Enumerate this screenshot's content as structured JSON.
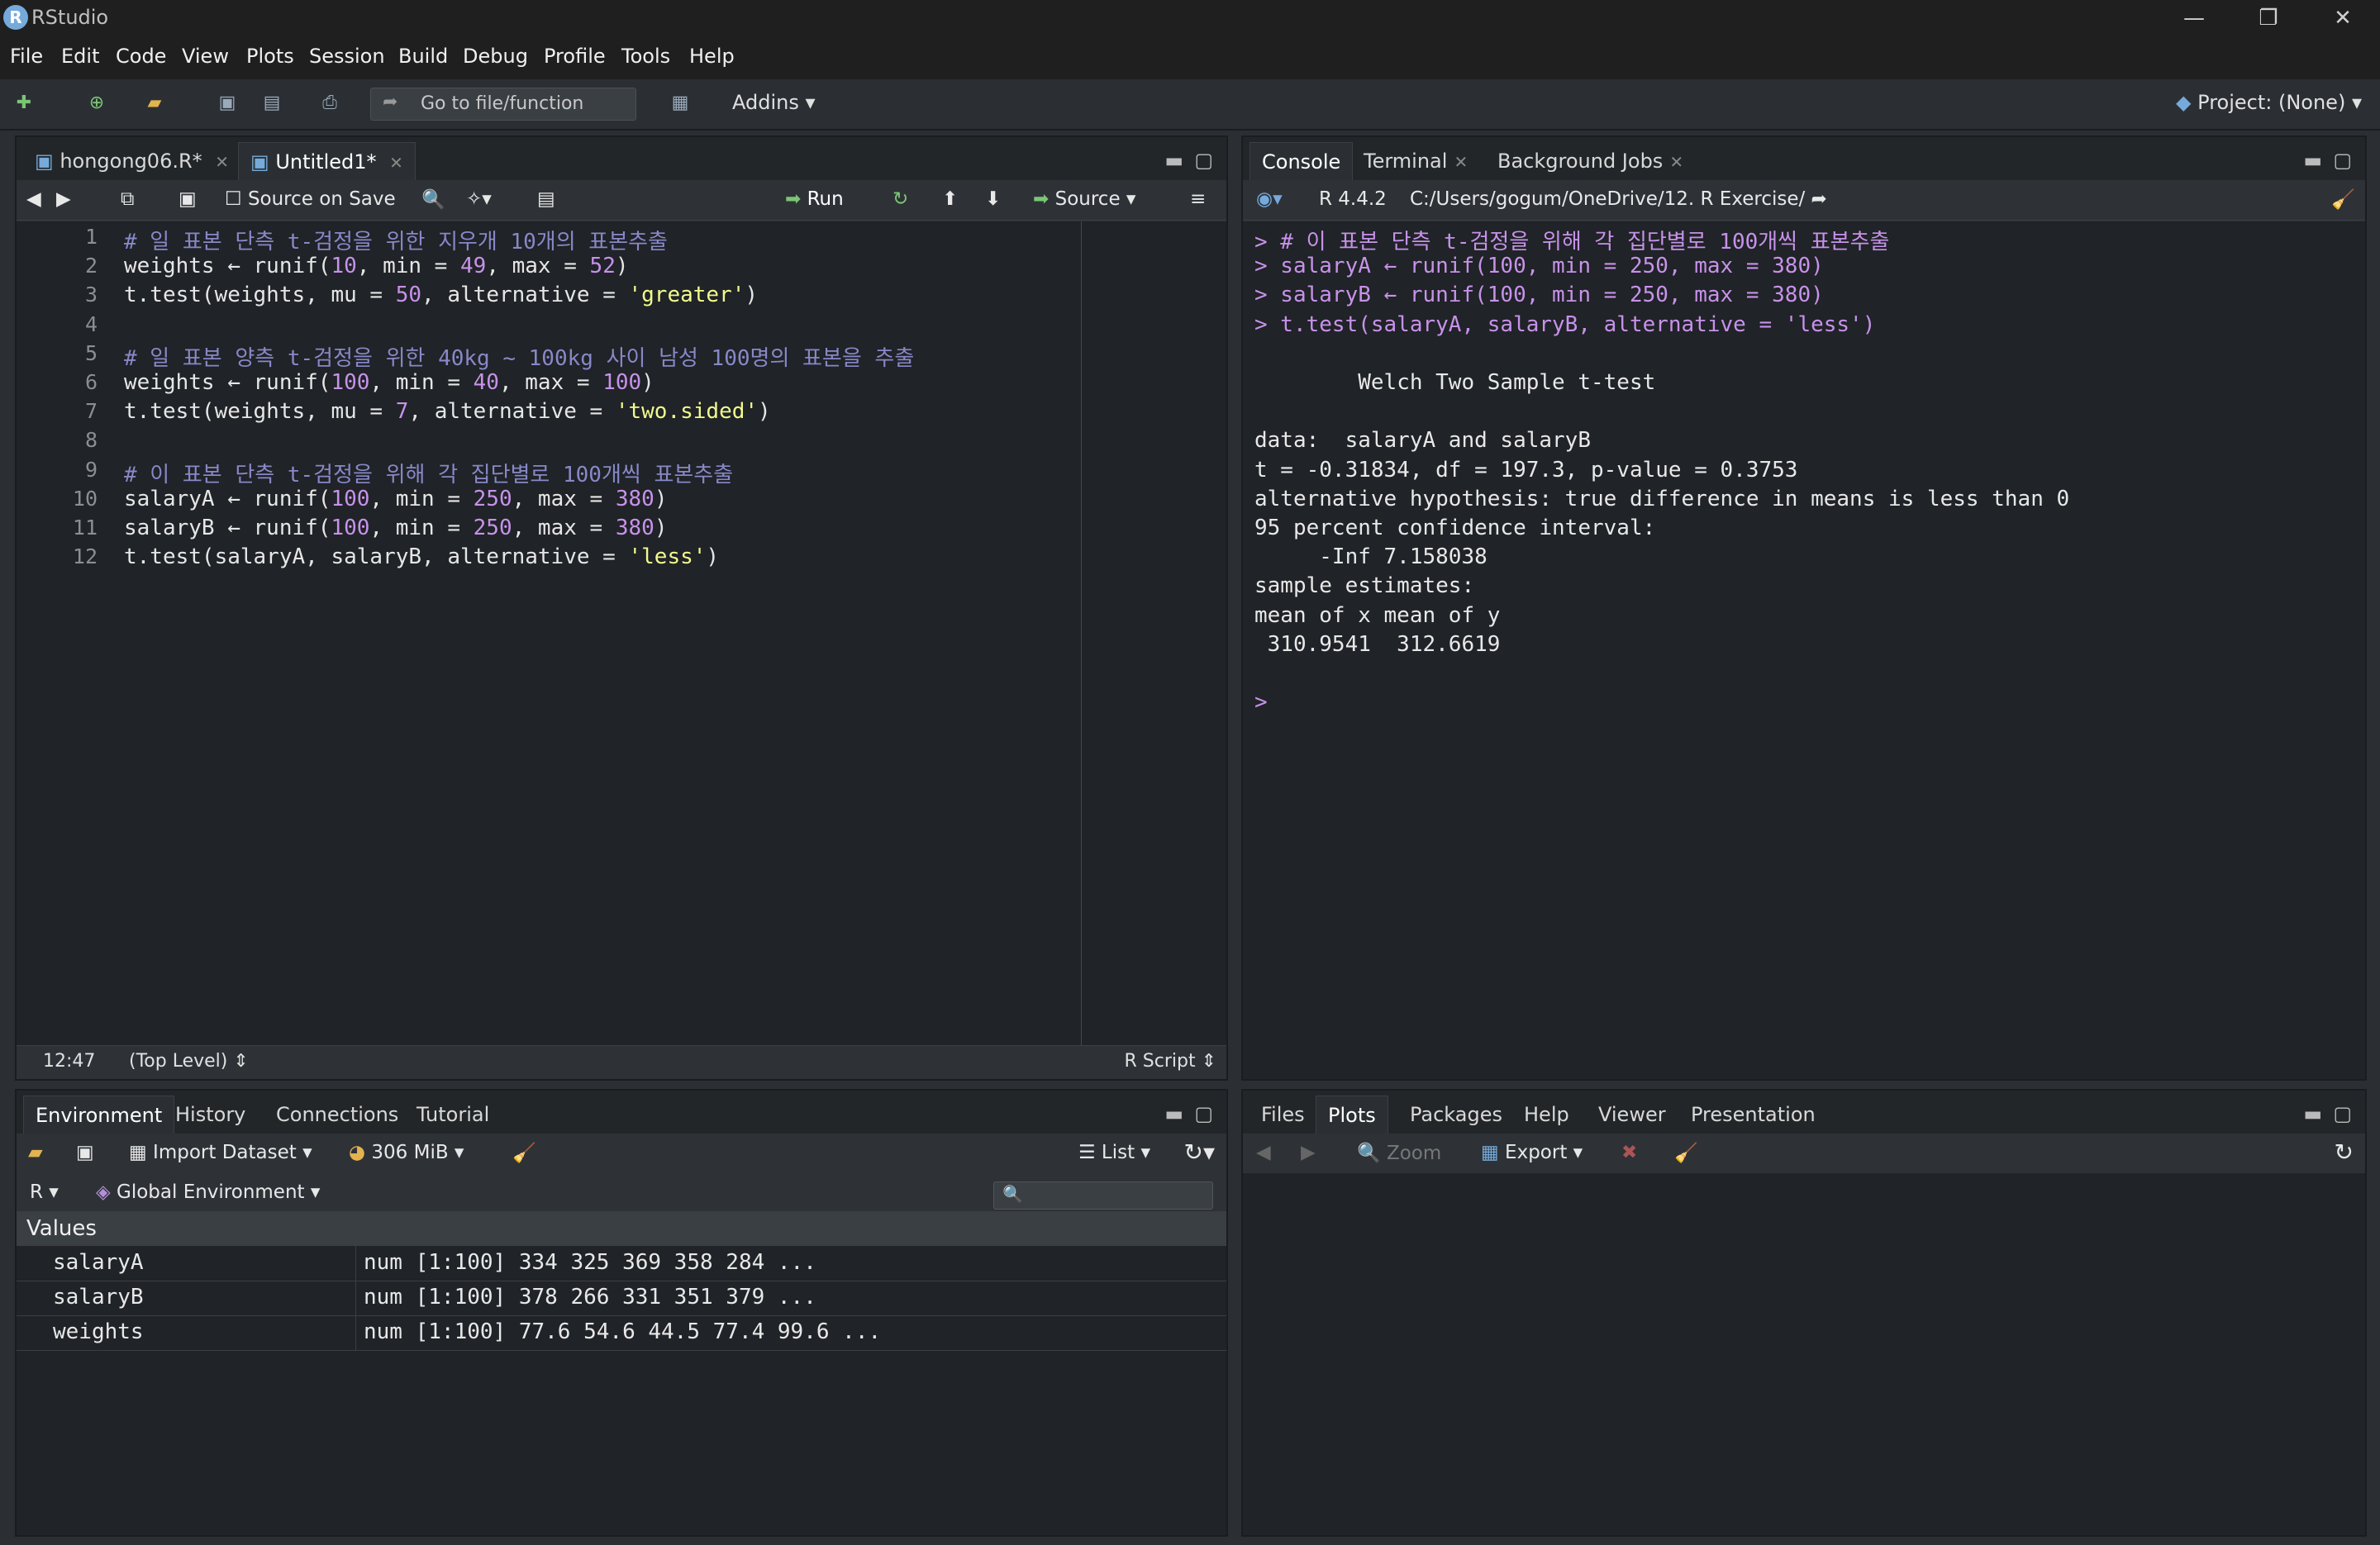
{
  "window": {
    "title": "RStudio",
    "controls": [
      "—",
      "❐",
      "✕"
    ]
  },
  "menu": [
    "File",
    "Edit",
    "Code",
    "View",
    "Plots",
    "Session",
    "Build",
    "Debug",
    "Profile",
    "Tools",
    "Help"
  ],
  "toolbar": {
    "goto_placeholder": "Go to file/function",
    "addins_label": "Addins",
    "project_label": "Project: (None)"
  },
  "editor": {
    "tabs": [
      {
        "label": "hongong06.R*",
        "active": false
      },
      {
        "label": "Untitled1*",
        "active": true
      }
    ],
    "source_on_save": "Source on Save",
    "run_label": "Run",
    "source_label": "Source",
    "lines": [
      {
        "n": "1",
        "parts": [
          {
            "t": "# 일 표본 단측 t-검정을 위한 지우개 10개의 표본추출",
            "c": "comment"
          }
        ]
      },
      {
        "n": "2",
        "parts": [
          {
            "t": "weights ← runif(",
            "c": "op"
          },
          {
            "t": "10",
            "c": "num"
          },
          {
            "t": ", min = ",
            "c": "op"
          },
          {
            "t": "49",
            "c": "num"
          },
          {
            "t": ", max = ",
            "c": "op"
          },
          {
            "t": "52",
            "c": "num"
          },
          {
            "t": ")",
            "c": "op"
          }
        ]
      },
      {
        "n": "3",
        "parts": [
          {
            "t": "t.test(weights, mu = ",
            "c": "op"
          },
          {
            "t": "50",
            "c": "num"
          },
          {
            "t": ", alternative = ",
            "c": "op"
          },
          {
            "t": "'greater'",
            "c": "str"
          },
          {
            "t": ")",
            "c": "op"
          }
        ]
      },
      {
        "n": "4",
        "parts": []
      },
      {
        "n": "5",
        "parts": [
          {
            "t": "# 일 표본 양측 t-검정을 위한 40kg ~ 100kg 사이 남성 100명의 표본을 추출",
            "c": "comment"
          }
        ]
      },
      {
        "n": "6",
        "parts": [
          {
            "t": "weights ← runif(",
            "c": "op"
          },
          {
            "t": "100",
            "c": "num"
          },
          {
            "t": ", min = ",
            "c": "op"
          },
          {
            "t": "40",
            "c": "num"
          },
          {
            "t": ", max = ",
            "c": "op"
          },
          {
            "t": "100",
            "c": "num"
          },
          {
            "t": ")",
            "c": "op"
          }
        ]
      },
      {
        "n": "7",
        "parts": [
          {
            "t": "t.test(weights, mu = ",
            "c": "op"
          },
          {
            "t": "7",
            "c": "num"
          },
          {
            "t": ", alternative = ",
            "c": "op"
          },
          {
            "t": "'two.sided'",
            "c": "str"
          },
          {
            "t": ")",
            "c": "op"
          }
        ]
      },
      {
        "n": "8",
        "parts": []
      },
      {
        "n": "9",
        "parts": [
          {
            "t": "# 이 표본 단측 t-검정을 위해 각 집단별로 100개씩 표본추출",
            "c": "comment"
          }
        ]
      },
      {
        "n": "10",
        "parts": [
          {
            "t": "salaryA ← runif(",
            "c": "op"
          },
          {
            "t": "100",
            "c": "num"
          },
          {
            "t": ", min = ",
            "c": "op"
          },
          {
            "t": "250",
            "c": "num"
          },
          {
            "t": ", max = ",
            "c": "op"
          },
          {
            "t": "380",
            "c": "num"
          },
          {
            "t": ")",
            "c": "op"
          }
        ]
      },
      {
        "n": "11",
        "parts": [
          {
            "t": "salaryB ← runif(",
            "c": "op"
          },
          {
            "t": "100",
            "c": "num"
          },
          {
            "t": ", min = ",
            "c": "op"
          },
          {
            "t": "250",
            "c": "num"
          },
          {
            "t": ", max = ",
            "c": "op"
          },
          {
            "t": "380",
            "c": "num"
          },
          {
            "t": ")",
            "c": "op"
          }
        ]
      },
      {
        "n": "12",
        "parts": [
          {
            "t": "t.test(salaryA, salaryB, alternative = ",
            "c": "op"
          },
          {
            "t": "'less'",
            "c": "str"
          },
          {
            "t": ")",
            "c": "op"
          }
        ]
      }
    ],
    "status_position": "12:47",
    "status_scope": "(Top Level) ⇕",
    "status_filetype": "R Script ⇕"
  },
  "console": {
    "tabs": [
      {
        "label": "Console",
        "active": true,
        "closable": false
      },
      {
        "label": "Terminal",
        "active": false,
        "closable": true
      },
      {
        "label": "Background Jobs",
        "active": false,
        "closable": true
      }
    ],
    "r_version": "R 4.4.2",
    "path": "C:/Users/gogum/OneDrive/12. R Exercise/",
    "lines": [
      {
        "t": "> # 이 표본 단측 t-검정을 위해 각 집단별로 100개씩 표본추출",
        "in": true
      },
      {
        "t": "> salaryA ← runif(100, min = 250, max = 380)",
        "in": true
      },
      {
        "t": "> salaryB ← runif(100, min = 250, max = 380)",
        "in": true
      },
      {
        "t": "> t.test(salaryA, salaryB, alternative = 'less')",
        "in": true
      },
      {
        "t": "",
        "in": false
      },
      {
        "t": "\tWelch Two Sample t-test",
        "in": false
      },
      {
        "t": "",
        "in": false
      },
      {
        "t": "data:  salaryA and salaryB",
        "in": false
      },
      {
        "t": "t = -0.31834, df = 197.3, p-value = 0.3753",
        "in": false
      },
      {
        "t": "alternative hypothesis: true difference in means is less than 0",
        "in": false
      },
      {
        "t": "95 percent confidence interval:",
        "in": false
      },
      {
        "t": "     -Inf 7.158038",
        "in": false
      },
      {
        "t": "sample estimates:",
        "in": false
      },
      {
        "t": "mean of x mean of y",
        "in": false
      },
      {
        "t": " 310.9541  312.6619",
        "in": false
      },
      {
        "t": "",
        "in": false
      },
      {
        "t": "> ",
        "in": true
      }
    ]
  },
  "environment": {
    "tabs": [
      {
        "label": "Environment",
        "active": true
      },
      {
        "label": "History",
        "active": false
      },
      {
        "label": "Connections",
        "active": false
      },
      {
        "label": "Tutorial",
        "active": false
      }
    ],
    "import_label": "Import Dataset",
    "memory_label": "306 MiB",
    "list_label": "List",
    "r_label": "R",
    "scope_label": "Global Environment",
    "section_label": "Values",
    "rows": [
      {
        "name": "salaryA",
        "value": "num [1:100] 334 325 369 358 284 ..."
      },
      {
        "name": "salaryB",
        "value": "num [1:100] 378 266 331 351 379 ..."
      },
      {
        "name": "weights",
        "value": "num [1:100] 77.6 54.6 44.5 77.4 99.6 ..."
      }
    ]
  },
  "files": {
    "tabs": [
      {
        "label": "Files",
        "active": false
      },
      {
        "label": "Plots",
        "active": true
      },
      {
        "label": "Packages",
        "active": false
      },
      {
        "label": "Help",
        "active": false
      },
      {
        "label": "Viewer",
        "active": false
      },
      {
        "label": "Presentation",
        "active": false
      }
    ],
    "zoom_label": "Zoom",
    "export_label": "Export"
  }
}
